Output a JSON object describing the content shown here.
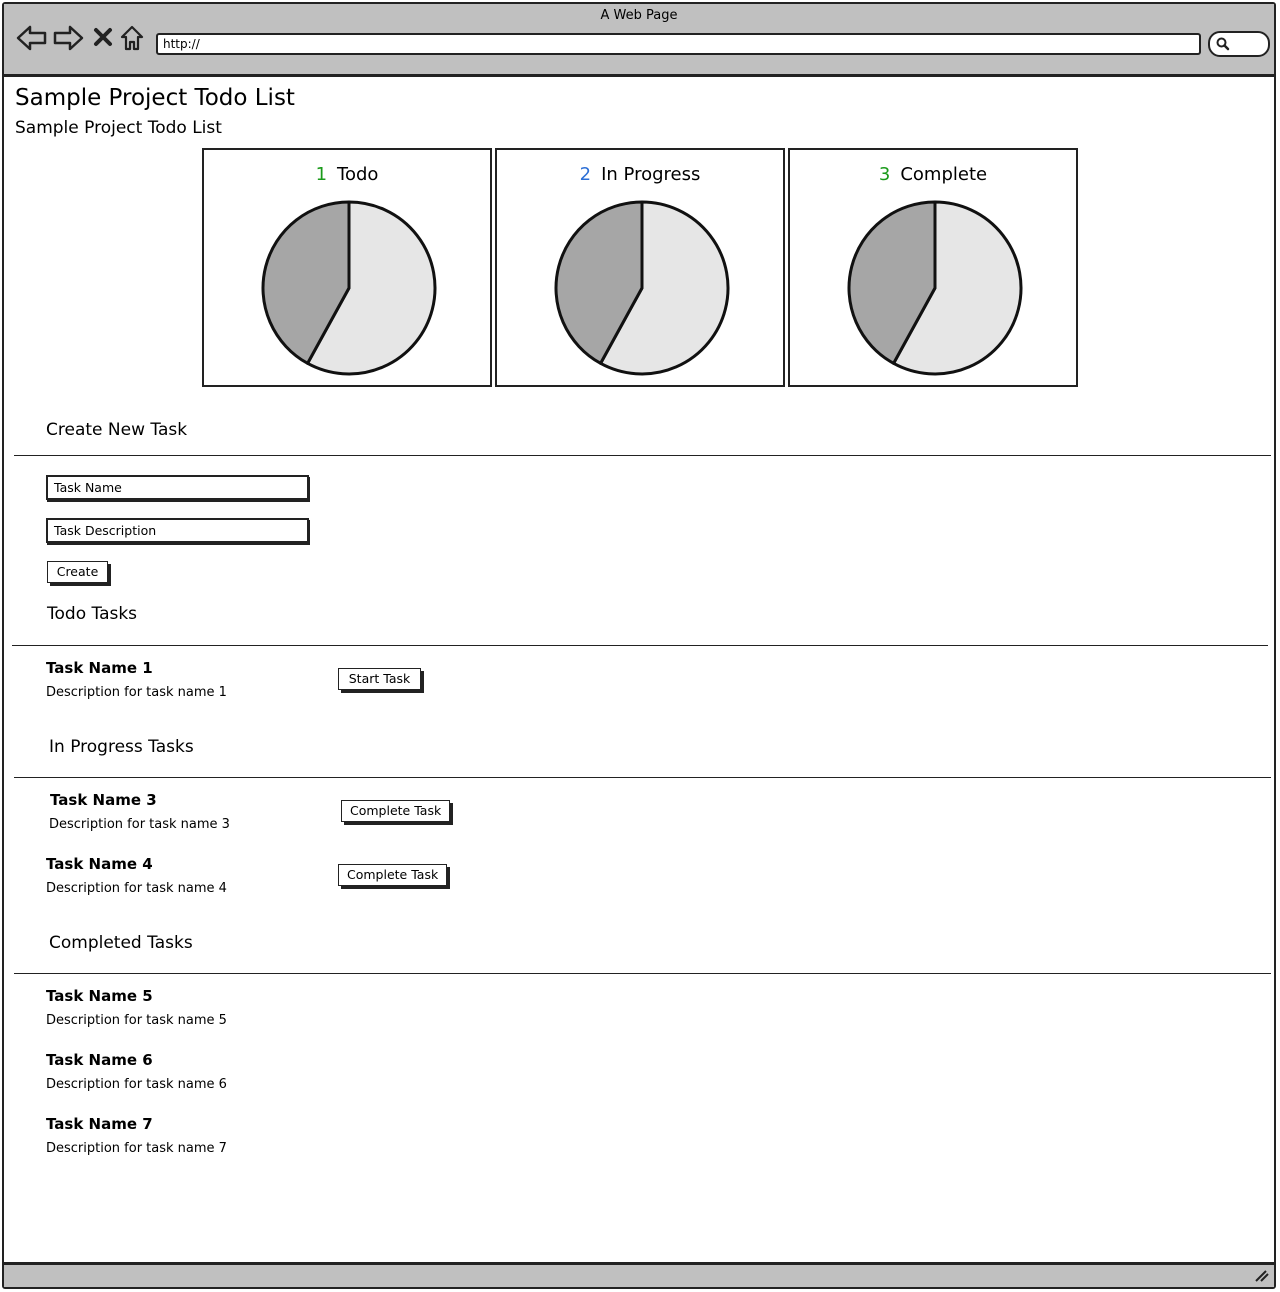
{
  "window": {
    "title": "A Web Page",
    "url": "http://"
  },
  "page": {
    "title": "Sample Project Todo List",
    "subtitle": "Sample Project Todo List"
  },
  "panels": [
    {
      "number": "1",
      "label": "Todo",
      "number_color": "#1a9a1a"
    },
    {
      "number": "2",
      "label": "In Progress",
      "number_color": "#2c6fd6"
    },
    {
      "number": "3",
      "label": "Complete",
      "number_color": "#1a9a1a"
    }
  ],
  "chart_data": [
    {
      "type": "pie",
      "slices": [
        {
          "value": 58,
          "color": "#e6e6e6"
        },
        {
          "value": 42,
          "color": "#a6a6a6"
        }
      ]
    },
    {
      "type": "pie",
      "slices": [
        {
          "value": 58,
          "color": "#e6e6e6"
        },
        {
          "value": 42,
          "color": "#a6a6a6"
        }
      ]
    },
    {
      "type": "pie",
      "slices": [
        {
          "value": 58,
          "color": "#e6e6e6"
        },
        {
          "value": 42,
          "color": "#a6a6a6"
        }
      ]
    }
  ],
  "create": {
    "heading": "Create New Task",
    "task_name_placeholder": "Task Name",
    "task_description_placeholder": "Task Description",
    "create_label": "Create"
  },
  "todo": {
    "heading": "Todo Tasks",
    "tasks": [
      {
        "name": "Task Name 1",
        "description": "Description for task name 1",
        "action": "Start Task"
      }
    ]
  },
  "in_progress": {
    "heading": "In Progress Tasks",
    "tasks": [
      {
        "name": "Task Name 3",
        "description": "Description for task name 3",
        "action": "Complete Task"
      },
      {
        "name": "Task Name 4",
        "description": "Description for task name 4",
        "action": "Complete Task"
      }
    ]
  },
  "completed": {
    "heading": "Completed Tasks",
    "tasks": [
      {
        "name": "Task Name 5",
        "description": "Description for task name 5"
      },
      {
        "name": "Task Name 6",
        "description": "Description for task name 6"
      },
      {
        "name": "Task Name 7",
        "description": "Description for task name 7"
      }
    ]
  }
}
